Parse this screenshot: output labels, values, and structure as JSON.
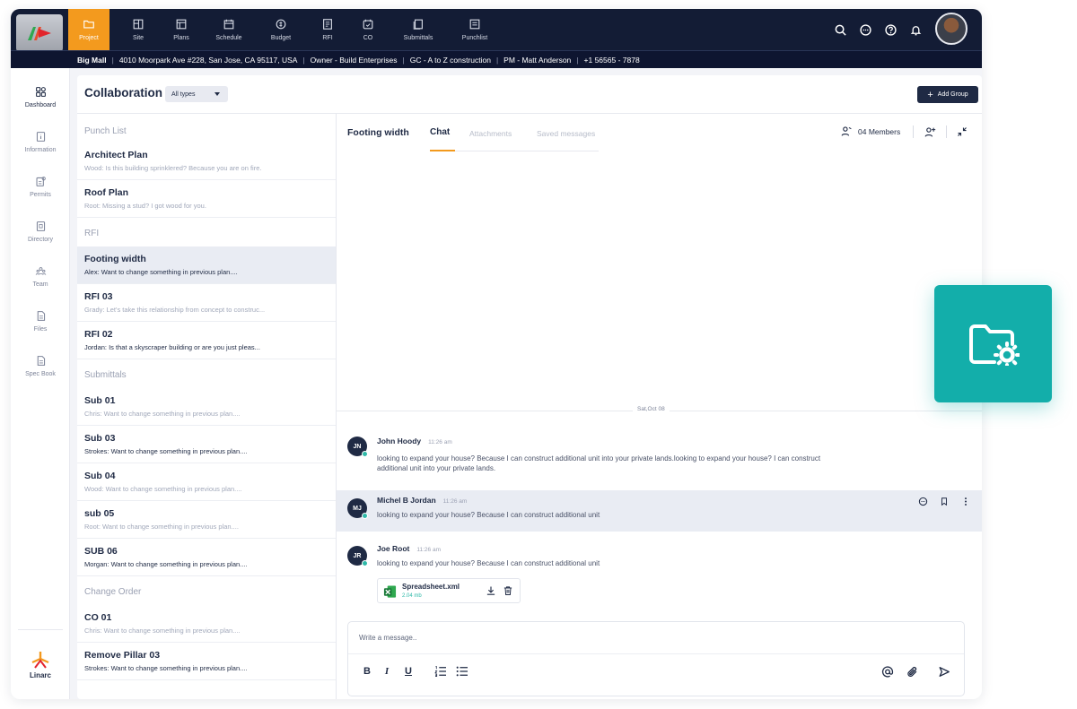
{
  "colors": {
    "nav_bg": "#131c35",
    "accent": "#f39a1e",
    "teal": "#13aeaa",
    "text": "#1f2a44"
  },
  "topnav": {
    "items": [
      {
        "label": "Project",
        "icon": "folder-icon",
        "active": true
      },
      {
        "label": "Site",
        "icon": "site-icon"
      },
      {
        "label": "Plans",
        "icon": "plans-icon"
      },
      {
        "label": "Schedule",
        "icon": "calendar-icon"
      },
      {
        "label": "Budget",
        "icon": "budget-icon"
      },
      {
        "label": "RFI",
        "icon": "rfi-icon"
      },
      {
        "label": "CO",
        "icon": "co-icon"
      },
      {
        "label": "Submittals",
        "icon": "submittals-icon"
      },
      {
        "label": "Punchlist",
        "icon": "punchlist-icon"
      }
    ],
    "right_icons": [
      "search-icon",
      "chat-icon",
      "help-icon",
      "bell-icon"
    ]
  },
  "infobar": {
    "project": "Big Mall",
    "address": "4010 Moorpark Ave #228, San Jose, CA 95117, USA",
    "owner": "Owner - Build Enterprises",
    "gc": "GC - A to Z construction",
    "pm": "PM - Matt Anderson",
    "phone": "+1 56565 - 7878"
  },
  "sidebar": {
    "items": [
      {
        "label": "Dashboard",
        "icon": "dashboard-icon",
        "active": true
      },
      {
        "label": "Information",
        "icon": "information-icon"
      },
      {
        "label": "Permits",
        "icon": "permits-icon"
      },
      {
        "label": "Directory",
        "icon": "directory-icon"
      },
      {
        "label": "Team",
        "icon": "team-icon"
      },
      {
        "label": "Files",
        "icon": "files-icon"
      },
      {
        "label": "Spec Book",
        "icon": "spec-book-icon"
      }
    ],
    "brand": "Linarc"
  },
  "collaboration": {
    "title": "Collaboration",
    "filter": "All types",
    "add_group": "Add Group",
    "groups": [
      {
        "heading": "Punch List",
        "channels": [
          {
            "name": "Architect Plan",
            "preview": "Wood: Is this building sprinklered? Because you are on fire."
          },
          {
            "name": "Roof Plan",
            "preview": "Root: Missing a stud? I got wood for you."
          }
        ]
      },
      {
        "heading": "RFI",
        "channels": [
          {
            "name": "Footing width",
            "preview": "Alex: Want to change something in previous plan....",
            "active": true
          },
          {
            "name": "RFI 03",
            "preview": "Grady: Let's take this relationship from concept to construc..."
          },
          {
            "name": "RFI 02",
            "preview": "Jordan: Is that a skyscraper building or are you just pleas..."
          }
        ]
      },
      {
        "heading": "Submittals",
        "channels": [
          {
            "name": "Sub 01",
            "preview": "Chris: Want to change something in previous plan...."
          },
          {
            "name": "Sub 03",
            "preview": "Strokes: Want to change something in previous plan...."
          },
          {
            "name": "Sub 04",
            "preview": "Wood: Want to change something in previous plan...."
          },
          {
            "name": "sub 05",
            "preview": "Root: Want to change something in previous plan...."
          },
          {
            "name": "SUB 06",
            "preview": "Morgan: Want to change something in previous plan...."
          }
        ]
      },
      {
        "heading": "Change Order",
        "channels": [
          {
            "name": "CO 01",
            "preview": "Chris: Want to change something in previous plan...."
          },
          {
            "name": "Remove Pillar 03",
            "preview": "Strokes: Want to change something in previous plan...."
          }
        ]
      }
    ]
  },
  "chat": {
    "title": "Footing width",
    "tabs": [
      "Chat",
      "Attachments",
      "Saved messages"
    ],
    "members": "04 Members",
    "date_separator": "Sat,Oct 08",
    "messages": [
      {
        "initials": "JN",
        "name": "John Hoody",
        "time": "11:26 am",
        "text": "looking to expand your house? Because I can construct additional unit into your private lands.looking to expand your house?  I can construct additional unit into your private lands."
      },
      {
        "initials": "MJ",
        "name": "Michel B Jordan",
        "time": "11:26 am",
        "text": "looking to expand your house? Because I can construct additional unit"
      },
      {
        "initials": "JR",
        "name": "Joe Root",
        "time": "11:26 am",
        "text": "looking to expand your house? Because I can construct additional unit"
      }
    ],
    "attachment": {
      "name": "Spreadsheet.xml",
      "size": "2.04 mb"
    },
    "composer_placeholder": "Write a message.."
  }
}
